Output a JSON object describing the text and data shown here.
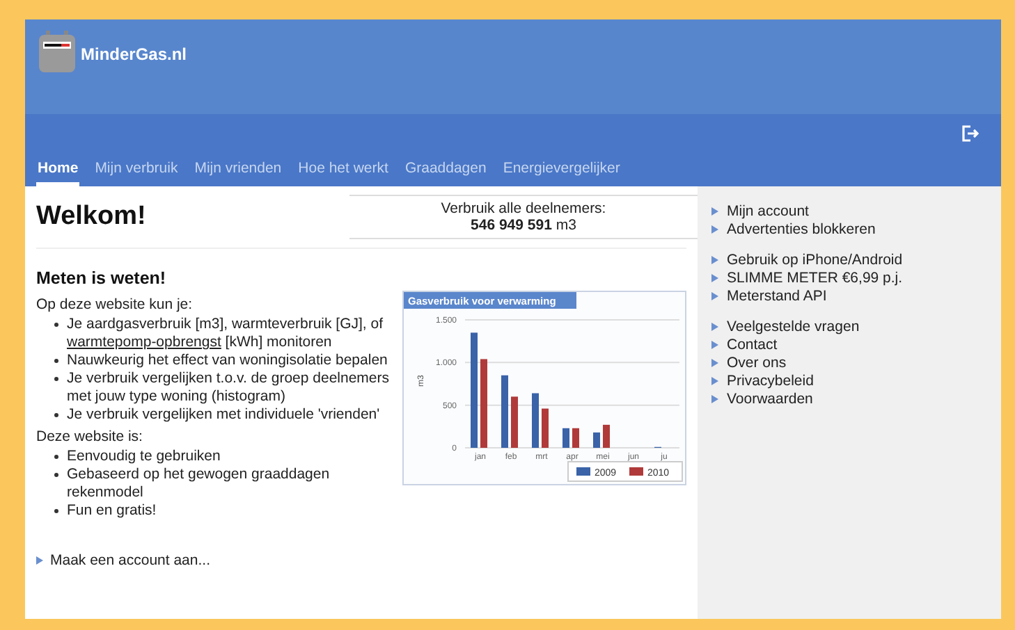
{
  "header": {
    "site_name": "MinderGas.nl"
  },
  "nav": {
    "tabs": [
      {
        "label": "Home",
        "selected": true
      },
      {
        "label": "Mijn verbruik",
        "selected": false
      },
      {
        "label": "Mijn vrienden",
        "selected": false
      },
      {
        "label": "Hoe het werkt",
        "selected": false
      },
      {
        "label": "Graaddagen",
        "selected": false
      },
      {
        "label": "Energievergelijker",
        "selected": false
      }
    ]
  },
  "welcome": {
    "title": "Welkom!",
    "stats_label": "Verbruik alle deelnemers:",
    "stats_value": "546 949 591",
    "stats_unit": "m3"
  },
  "intro": {
    "heading": "Meten is weten!",
    "lead": "Op deze website kun je:",
    "features": [
      {
        "text": "Je aardgasverbruik [m3], warmteverbruik [GJ], of ",
        "link": "warmtepomp-opbrengst",
        "after": " [kWh] monitoren"
      },
      {
        "text": "Nauwkeurig het effect van woningisolatie bepalen"
      },
      {
        "text": "Je verbruik vergelijken t.o.v. de groep deelnemers met jouw type woning (histogram)"
      },
      {
        "text": "Je verbruik vergelijken met individuele 'vrienden'"
      }
    ],
    "lead2": "Deze website is:",
    "qualities": [
      "Eenvoudig te gebruiken",
      "Gebaseerd op het gewogen graaddagen rekenmodel",
      "Fun en gratis!"
    ],
    "cta": "Maak een account aan..."
  },
  "chart": {
    "chart_data": {
      "type": "bar",
      "title": "Gasverbruik voor verwarming",
      "ylabel": "m3",
      "categories": [
        "jan",
        "feb",
        "mrt",
        "apr",
        "mei",
        "jun",
        "ju"
      ],
      "series": [
        {
          "name": "2009",
          "color": "#3a63a8",
          "values": [
            1350,
            850,
            640,
            230,
            180,
            null,
            10
          ]
        },
        {
          "name": "2010",
          "color": "#b03a3a",
          "values": [
            1040,
            600,
            460,
            230,
            270,
            null,
            null
          ]
        }
      ],
      "legend": "bottom-right",
      "ylim": [
        0,
        1500
      ],
      "yticks": [
        0,
        {
          "value": 500,
          "label": "500"
        },
        {
          "value": 1000,
          "label": "1.000"
        },
        {
          "value": 1500,
          "label": "1.500"
        }
      ]
    }
  },
  "sidebar": {
    "groups": [
      [
        "Mijn account",
        "Advertenties blokkeren"
      ],
      [
        "Gebruik op iPhone/Android",
        "SLIMME METER €6,99 p.j.",
        "Meterstand API"
      ],
      [
        "Veelgestelde vragen",
        "Contact",
        "Over ons",
        "Privacybeleid",
        "Voorwaarden"
      ]
    ]
  }
}
